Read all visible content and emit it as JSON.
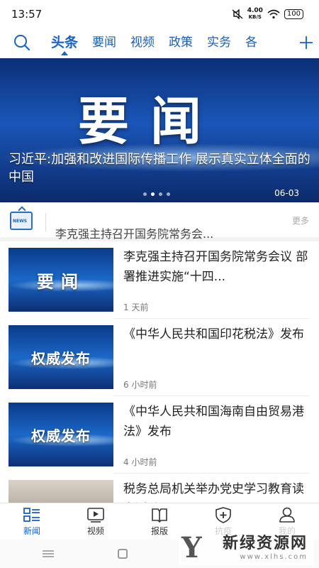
{
  "status": {
    "time": "13:57",
    "net_speed_value": "4.00",
    "net_speed_unit": "KB/S",
    "battery": "100"
  },
  "tabs": [
    {
      "label": "头条",
      "active": true
    },
    {
      "label": "要闻",
      "active": false
    },
    {
      "label": "视频",
      "active": false
    },
    {
      "label": "政策",
      "active": false
    },
    {
      "label": "实务",
      "active": false
    },
    {
      "label": "各",
      "active": false
    }
  ],
  "icons": {
    "search": "search-icon",
    "add": "plus-icon"
  },
  "banner": {
    "image_text": "要闻",
    "headline": "习近平:加强和改进国际传播工作 展示真实立体全面的中国",
    "date": "06-03",
    "dots": 4,
    "active_dot": 1
  },
  "ticker": {
    "icon_text": "NEWS",
    "text": "李克强主持召开国务院常务会...",
    "more": "更多"
  },
  "news": [
    {
      "thumb_text": "要闻",
      "thumb_style": "yw",
      "title": "李克强主持召开国务院常务会议 部署推进实施“十四...",
      "time": "1 天前"
    },
    {
      "thumb_text": "权威发布",
      "thumb_style": "qw",
      "title": "《中华人民共和国印花税法》发布",
      "time": "6 小时前"
    },
    {
      "thumb_text": "权威发布",
      "thumb_style": "qw",
      "title": "《中华人民共和国海南自由贸易港法》发布",
      "time": "4 小时前"
    },
    {
      "thumb_text": "",
      "thumb_style": "photo",
      "title": "税务总局机关举办党史学习教育读书活动",
      "time": ""
    }
  ],
  "bottom_nav": [
    {
      "label": "新闻",
      "icon": "news-list-icon",
      "active": true
    },
    {
      "label": "视频",
      "icon": "video-play-icon",
      "active": false
    },
    {
      "label": "报版",
      "icon": "newspaper-icon",
      "active": false
    },
    {
      "label": "抗疫",
      "icon": "shield-plus-icon",
      "active": false
    },
    {
      "label": "我的",
      "icon": "user-icon",
      "active": false
    }
  ],
  "watermark": {
    "title": "新绿资源网",
    "url": "www.xlhs.com"
  },
  "colors": {
    "accent": "#1862c6",
    "banner_dark": "#0b2f78"
  }
}
